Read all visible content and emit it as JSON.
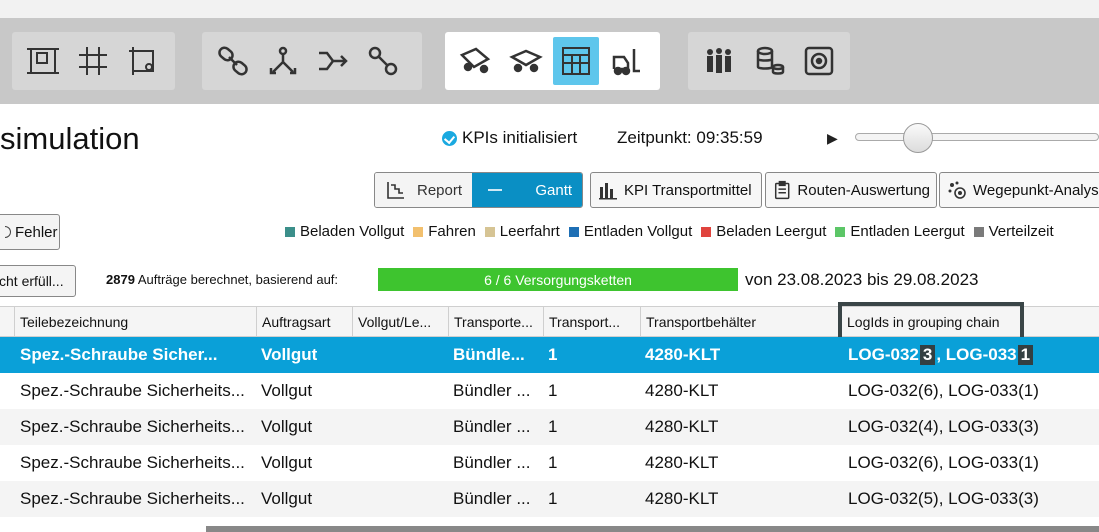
{
  "header": {
    "title": "simulation",
    "kpi_status": "KPIs initialisiert",
    "time": "Zeitpunkt: 09:35:59"
  },
  "toolbar": {
    "groups": [
      [
        "layout-icon",
        "grid-icon",
        "area-icon"
      ],
      [
        "chain-link-icon",
        "split-icon",
        "merge-icon",
        "route-chain-icon"
      ],
      [
        "vehicle-icon",
        "transporter-icon",
        "container-table-icon",
        "forklift-icon"
      ],
      [
        "workers-icon",
        "stock-icon",
        "target-icon"
      ]
    ],
    "active": "container-table-icon"
  },
  "view_toggle": {
    "report": "Report",
    "gantt": "Gantt"
  },
  "views": {
    "kpi_transport": "KPI Transportmittel",
    "route_eval": "Routen-Auswertung",
    "waypoint": "Wegepunkt-Analyse"
  },
  "errors_button": "Fehler",
  "filter_button": "cht erfüll...",
  "legend": [
    {
      "label": "Beladen Vollgut",
      "color": "#3b8f8a"
    },
    {
      "label": "Fahren",
      "color": "#f2c06e"
    },
    {
      "label": "Leerfahrt",
      "color": "#d6c494"
    },
    {
      "label": "Entladen Vollgut",
      "color": "#1e6fb5"
    },
    {
      "label": "Beladen Leergut",
      "color": "#e0443e"
    },
    {
      "label": "Entladen Leergut",
      "color": "#5cc667"
    },
    {
      "label": "Verteilzeit",
      "color": "#7a7a7a"
    }
  ],
  "summary": {
    "count": "2879",
    "text": "Aufträge berechnet, basierend auf:",
    "progress": "6 / 6 Versorgungsketten",
    "progress_fraction": 1.0,
    "range": "von 23.08.2023 bis 29.08.2023"
  },
  "table": {
    "columns": [
      "Teilebezeichnung",
      "Auftragsart",
      "Vollgut/Le...",
      "Transporte...",
      "Transport...",
      "Transportbehälter",
      "LogIds in grouping chain"
    ],
    "rows": [
      {
        "part": "Spez.-Schraube Sicher...",
        "type": "Vollgut",
        "vl": "",
        "tr": "Bündle...",
        "n": "1",
        "box": "4280-KLT",
        "logA": "LOG-032",
        "logAn": "3",
        "logB": ", LOG-033",
        "logBn": "1"
      },
      {
        "part": "Spez.-Schraube Sicherheits...",
        "type": "Vollgut",
        "vl": "",
        "tr": "Bündler ...",
        "n": "1",
        "box": "4280-KLT",
        "log": "LOG-032(6), LOG-033(1)"
      },
      {
        "part": "Spez.-Schraube Sicherheits...",
        "type": "Vollgut",
        "vl": "",
        "tr": "Bündler ...",
        "n": "1",
        "box": "4280-KLT",
        "log": "LOG-032(4), LOG-033(3)"
      },
      {
        "part": "Spez.-Schraube Sicherheits...",
        "type": "Vollgut",
        "vl": "",
        "tr": "Bündler ...",
        "n": "1",
        "box": "4280-KLT",
        "log": "LOG-032(6), LOG-033(1)"
      },
      {
        "part": "Spez.-Schraube Sicherheits...",
        "type": "Vollgut",
        "vl": "",
        "tr": "Bündler ...",
        "n": "1",
        "box": "4280-KLT",
        "log": "LOG-032(5), LOG-033(3)"
      }
    ]
  }
}
